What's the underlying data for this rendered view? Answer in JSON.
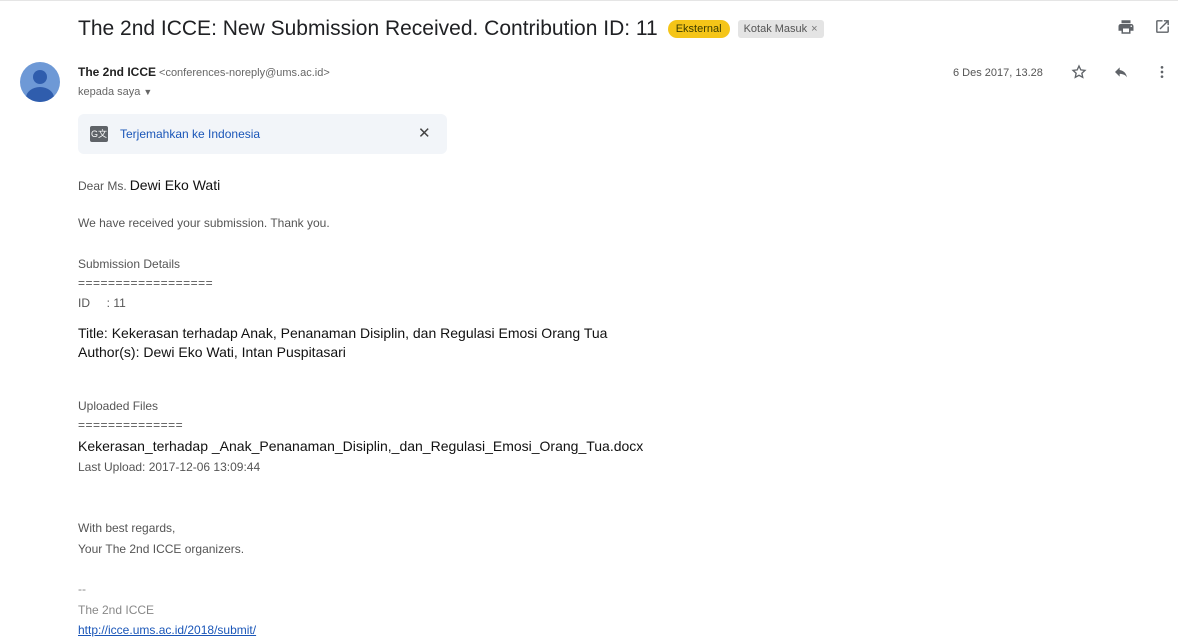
{
  "subject": "The 2nd ICCE: New Submission Received. Contribution ID: 11",
  "labels": {
    "external": "Eksternal",
    "inbox": "Kotak Masuk",
    "inbox_close": "×"
  },
  "sender": {
    "name": "The 2nd ICCE",
    "email": "<conferences-noreply@ums.ac.id>",
    "to": "kepada saya"
  },
  "date": "6 Des 2017, 13.28",
  "translate": {
    "link": "Terjemahkan ke Indonesia",
    "close": "✕"
  },
  "body": {
    "greeting": "Dear Ms.",
    "recipient_name": "Dewi Eko Wati",
    "line_received": "We have received your submission. Thank you.",
    "details_heading": "Submission Details",
    "details_rule": "==================",
    "id_line": "ID     : 11",
    "title_line": "Title: Kekerasan terhadap Anak, Penanaman Disiplin, dan Regulasi Emosi Orang Tua",
    "authors_line": "Author(s): Dewi Eko Wati, Intan Puspitasari",
    "uploaded_heading": "Uploaded Files",
    "uploaded_rule": "==============",
    "filename": "Kekerasan_terhadap _Anak_Penanaman_Disiplin,_dan_Regulasi_Emosi_Orang_Tua.docx",
    "last_upload": "Last Upload: 2017-12-06 13:09:44",
    "regards": "With best regards,",
    "organizers": "Your The 2nd ICCE organizers.",
    "sig_sep": "--",
    "sig_name": "The 2nd ICCE",
    "sig_link": "http://icce.ums.ac.id/2018/submit/"
  },
  "icons": {
    "print": "print-icon",
    "open_new": "open-in-new-window-icon",
    "star": "star-icon",
    "reply": "reply-icon",
    "more": "more-vert-icon",
    "translate": "translate-icon",
    "avatar": "avatar-icon"
  },
  "colors": {
    "external_badge": "#f5c518",
    "link": "#1a56b8",
    "avatar": "#6e99d6",
    "translate_bg": "#f2f5f9"
  }
}
